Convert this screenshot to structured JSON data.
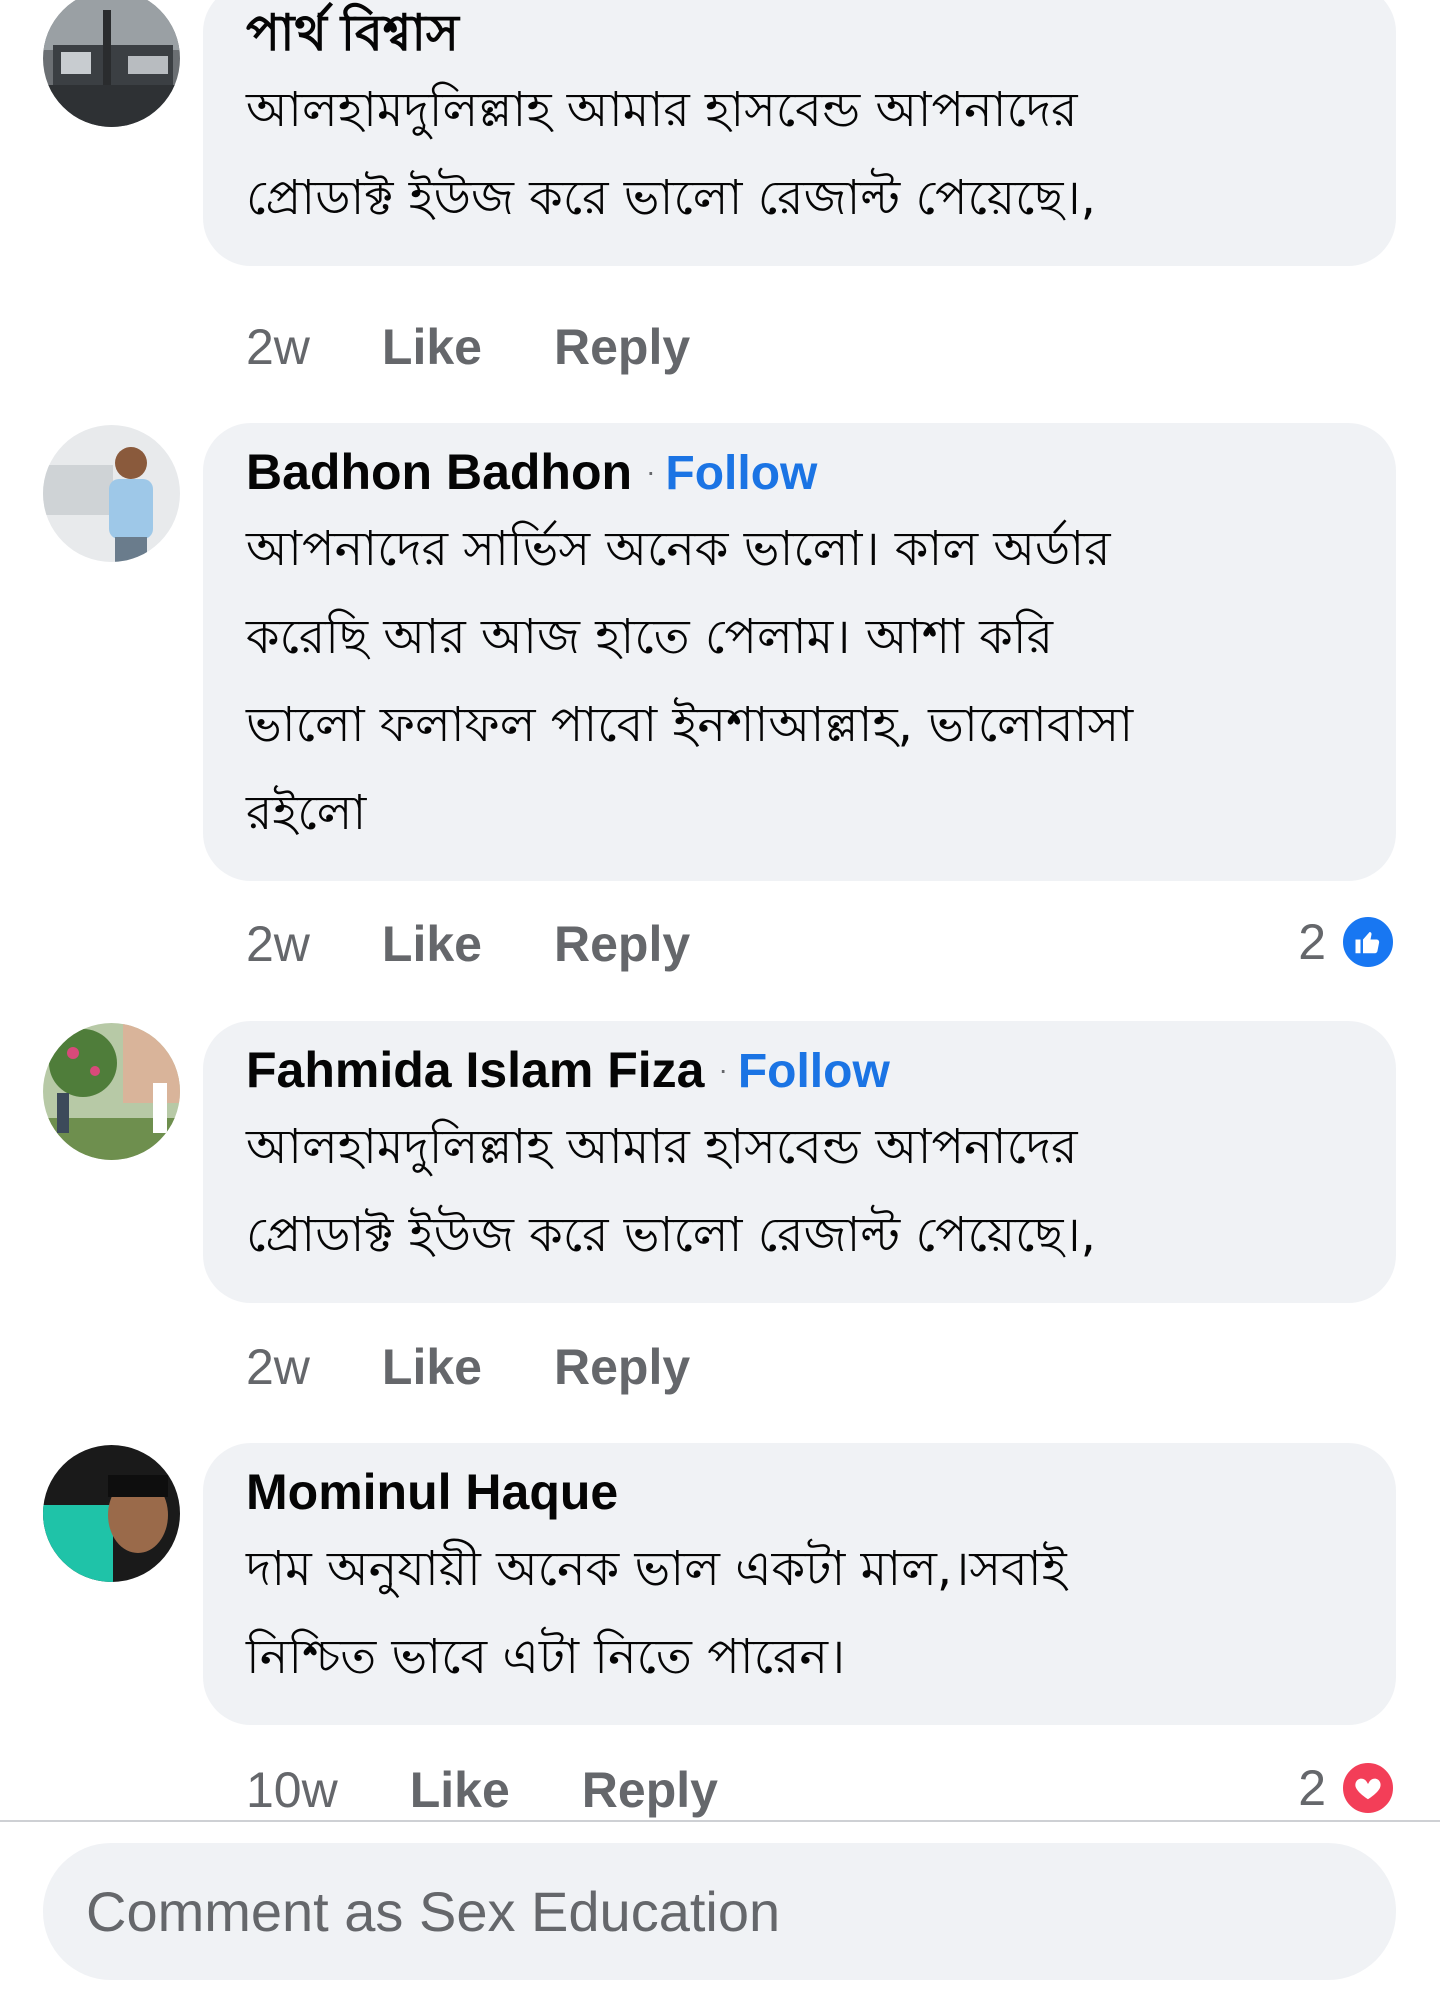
{
  "comments": [
    {
      "author": "পার্থ বিশ্বাস",
      "follow": "",
      "text_lines": [
        "আলহামদুলিল্লাহ আমার হাসবেন্ড  আপনাদের",
        "প্রোডাক্ট ইউজ করে ভালো রেজাল্ট পেয়েছে।,"
      ],
      "time": "2w",
      "like": "Like",
      "reply": "Reply",
      "reaction_count": "",
      "reaction_icon": ""
    },
    {
      "author": "Badhon Badhon",
      "follow": "Follow",
      "text_lines": [
        "আপনাদের সার্ভিস অনেক ভালো। কাল অর্ডার",
        "করেছি আর আজ হাতে পেলাম। আশা করি",
        "ভালো ফলাফল পাবো ইনশাআল্লাহ, ভালোবাসা",
        "রইলো"
      ],
      "time": "2w",
      "like": "Like",
      "reply": "Reply",
      "reaction_count": "2",
      "reaction_icon": "like-thumb-icon"
    },
    {
      "author": "Fahmida Islam Fiza",
      "follow": "Follow",
      "text_lines": [
        "আলহামদুলিল্লাহ আমার হাসবেন্ড  আপনাদের",
        "প্রোডাক্ট ইউজ করে ভালো রেজাল্ট পেয়েছে।,"
      ],
      "time": "2w",
      "like": "Like",
      "reply": "Reply",
      "reaction_count": "",
      "reaction_icon": ""
    },
    {
      "author": "Mominul Haque",
      "follow": "",
      "text_lines": [
        "দাম অনুযায়ী অনেক ভাল একটা মাল,।সবাই",
        "নিশ্চিত ভাবে এটা নিতে পারেন।"
      ],
      "time": "10w",
      "like": "Like",
      "reply": "Reply",
      "reaction_count": "2",
      "reaction_icon": "love-heart-icon"
    }
  ],
  "composer": {
    "placeholder": "Comment as Sex Education"
  },
  "colors": {
    "bubble": "#f0f2f5",
    "follow_link": "#1b74e4",
    "meta_text": "#65676b",
    "like_reaction": "#1877f2",
    "love_reaction": "#f33e58"
  }
}
